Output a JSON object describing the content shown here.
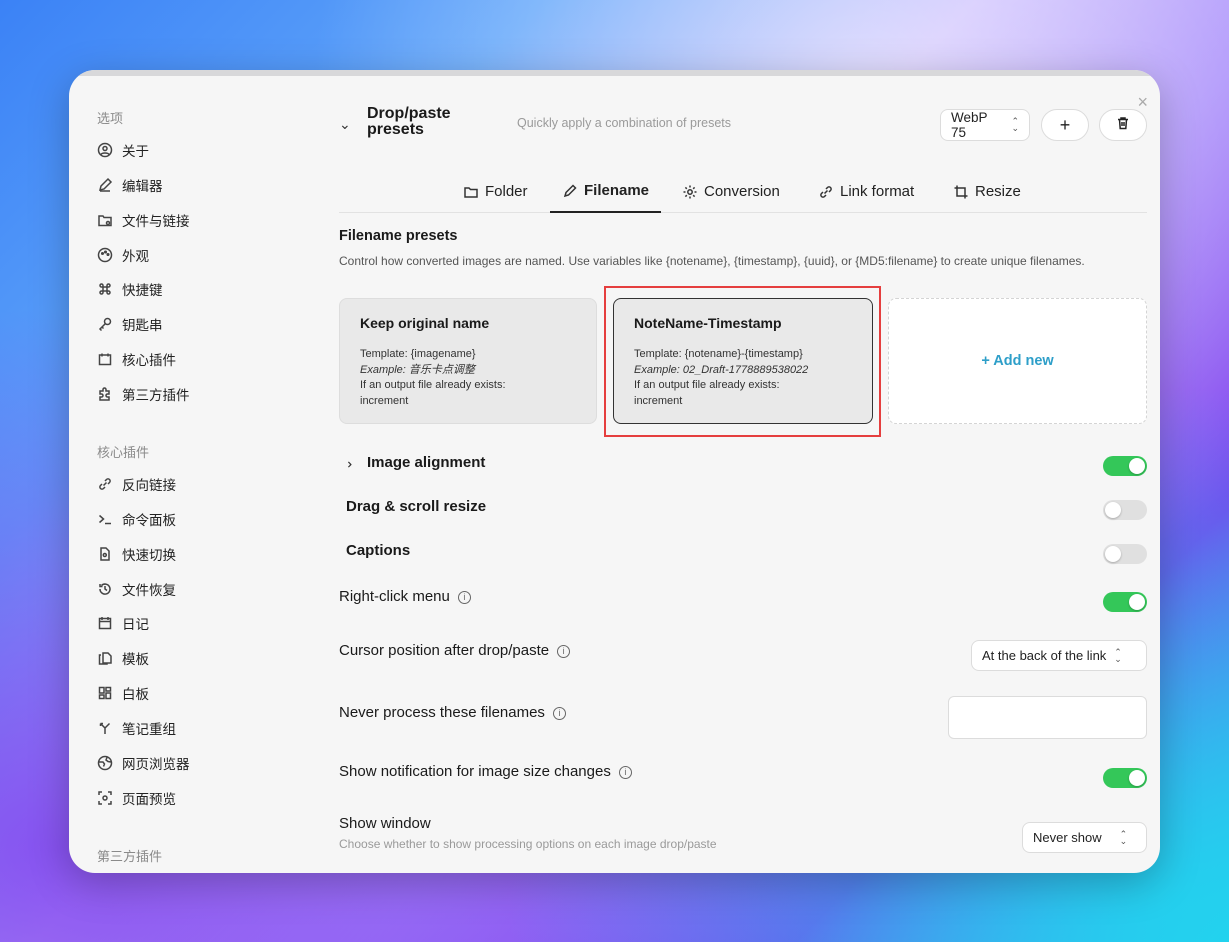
{
  "sidebar": {
    "section1": "选项",
    "items1": [
      "关于",
      "编辑器",
      "文件与链接",
      "外观",
      "快捷键",
      "钥匙串",
      "核心插件",
      "第三方插件"
    ],
    "section2": "核心插件",
    "items2": [
      "反向链接",
      "命令面板",
      "快速切换",
      "文件恢复",
      "日记",
      "模板",
      "白板",
      "笔记重组",
      "网页浏览器",
      "页面预览"
    ],
    "section3": "第三方插件"
  },
  "header": {
    "title": "Drop/paste presets",
    "description": "Quickly apply a combination of presets",
    "preset_select": "WebP 75",
    "add_icon": "plus-icon",
    "delete_icon": "trash-icon"
  },
  "tabs": [
    {
      "label": "Folder",
      "icon": "folder-icon"
    },
    {
      "label": "Filename",
      "icon": "pencil-icon",
      "active": true
    },
    {
      "label": "Conversion",
      "icon": "gear-icon"
    },
    {
      "label": "Link format",
      "icon": "link-icon"
    },
    {
      "label": "Resize",
      "icon": "crop-icon"
    }
  ],
  "filename_presets": {
    "title": "Filename presets",
    "description": "Control how converted images are named. Use variables like {notename}, {timestamp}, {uuid}, or {MD5:filename} to create unique filenames.",
    "cards": [
      {
        "title": "Keep original name",
        "template": "Template: {imagename}",
        "example": "Example: 音乐卡点调整",
        "conflict": "If an output file already exists: increment"
      },
      {
        "title": "NoteName-Timestamp",
        "template": "Template: {notename}-{timestamp}",
        "example": "Example: 02_Draft-1778889538022",
        "conflict": "If an output file already exists: increment"
      }
    ],
    "add_new": "+ Add new"
  },
  "settings": {
    "image_alignment": "Image alignment",
    "drag_scroll": "Drag & scroll resize",
    "captions": "Captions",
    "right_click": "Right-click menu",
    "cursor_position": "Cursor position after drop/paste",
    "cursor_value": "At the back of the link",
    "never_process": "Never process these filenames",
    "show_notification": "Show notification for image size changes",
    "show_window": "Show window",
    "show_window_desc": "Choose whether to show processing options on each image drop/paste",
    "show_window_value": "Never show",
    "info_glyph": "i"
  },
  "colors": {
    "accent": "#2e9fc9",
    "toggle_on": "#34c759",
    "highlight": "#e53e3e"
  }
}
